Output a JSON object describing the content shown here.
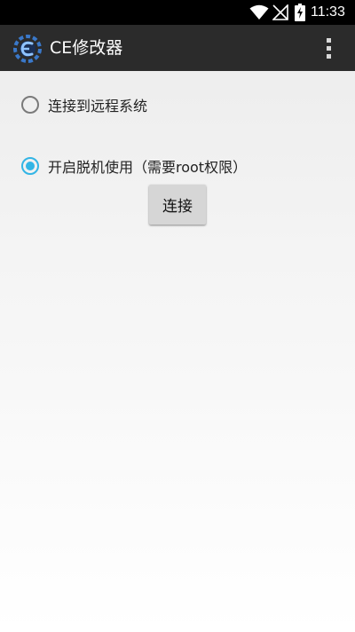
{
  "status_bar": {
    "time": "11:33",
    "icons": [
      "wifi-icon",
      "no-signal-icon",
      "battery-charging-icon"
    ]
  },
  "action_bar": {
    "title": "CE修改器",
    "logo_icon": "cheat-engine-logo-icon",
    "menu_icon": "overflow-menu-icon"
  },
  "options": [
    {
      "label": "连接到远程系统",
      "checked": false
    },
    {
      "label": "开启脱机使用（需要root权限）",
      "checked": true
    }
  ],
  "connect_button": {
    "label": "连接"
  },
  "colors": {
    "accent": "#33b5e5",
    "action_bar": "#2b2b2b",
    "status_bar": "#000000",
    "button": "#d6d6d6"
  }
}
